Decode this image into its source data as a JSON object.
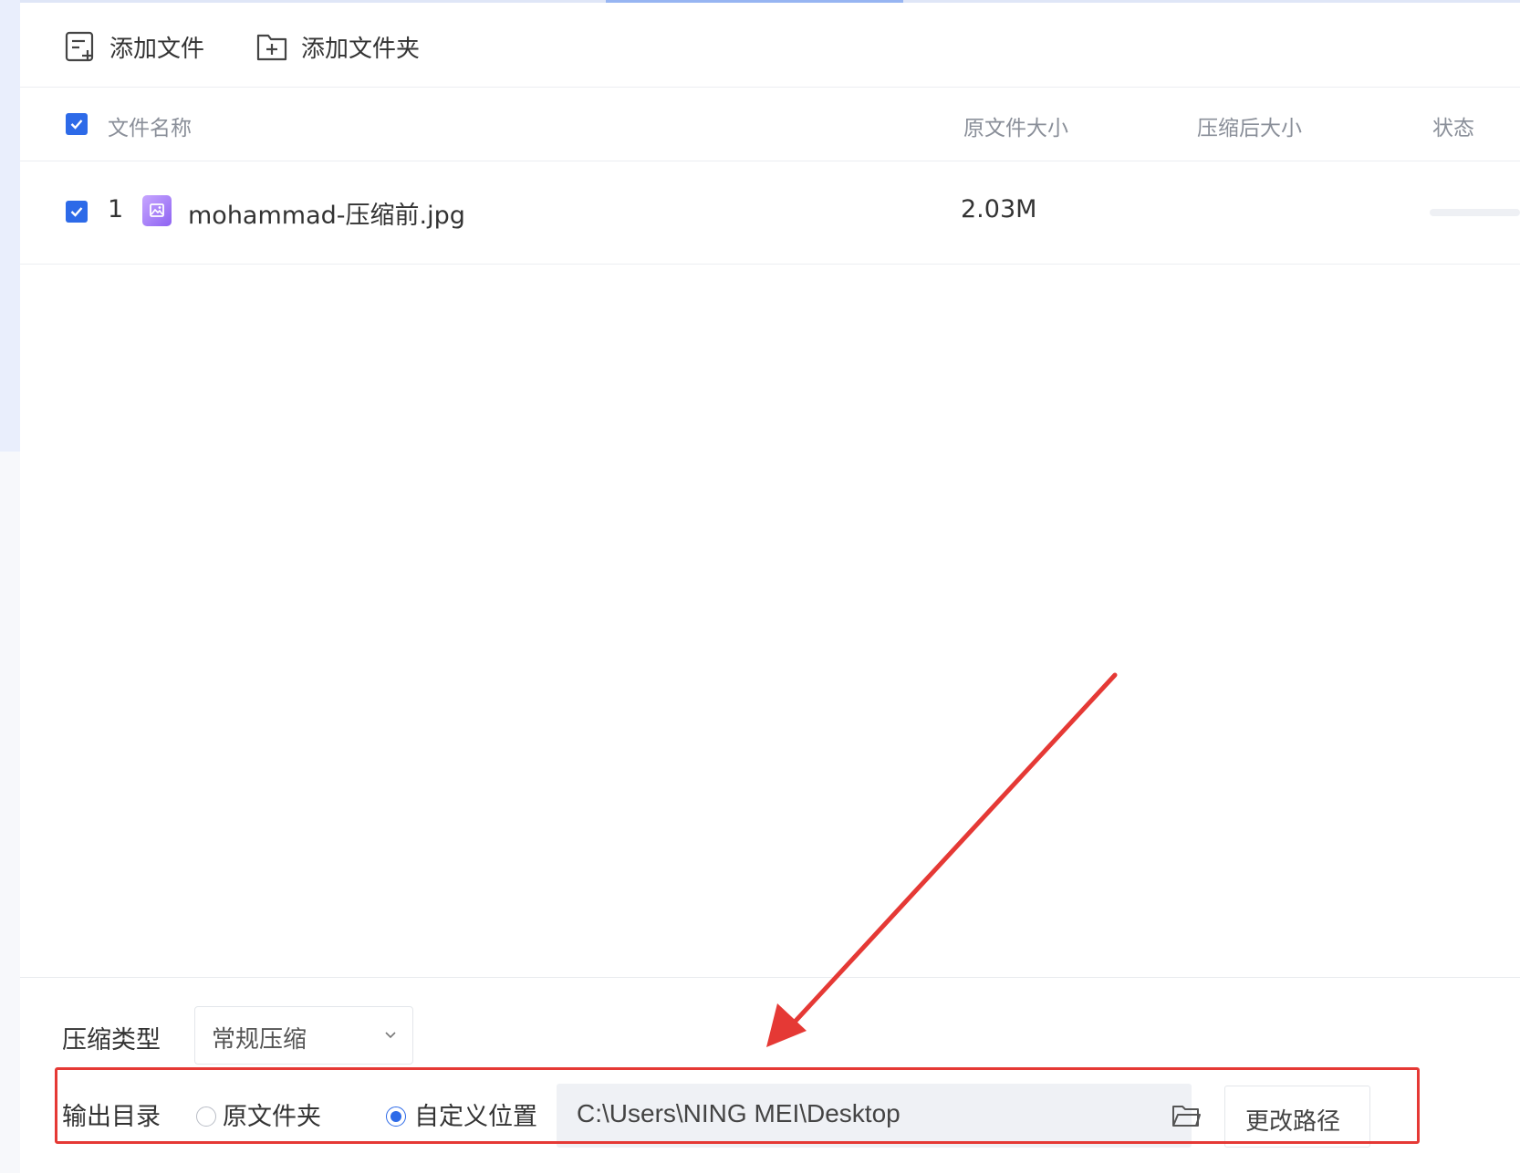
{
  "toolbar": {
    "add_file": "添加文件",
    "add_folder": "添加文件夹"
  },
  "table": {
    "headers": {
      "name": "文件名称",
      "original_size": "原文件大小",
      "compressed_size": "压缩后大小",
      "status": "状态"
    },
    "rows": [
      {
        "index": "1",
        "filename": "mohammad-压缩前.jpg",
        "original_size": "2.03M",
        "compressed_size": "",
        "status": ""
      }
    ]
  },
  "options": {
    "compression_type_label": "压缩类型",
    "compression_type_value": "常规压缩",
    "output_dir_label": "输出目录",
    "radio_original": "原文件夹",
    "radio_custom": "自定义位置",
    "selected_radio": "custom",
    "path_value": "C:\\Users\\NING MEI\\Desktop",
    "change_path_button": "更改路径"
  },
  "colors": {
    "accent": "#2d6ae8",
    "annotation": "#e53935"
  },
  "icons": {
    "add_file": "add-file-icon",
    "add_folder": "add-folder-icon",
    "file_type": "image-file-icon",
    "browse": "folder-open-icon",
    "dropdown": "chevron-down-icon"
  }
}
